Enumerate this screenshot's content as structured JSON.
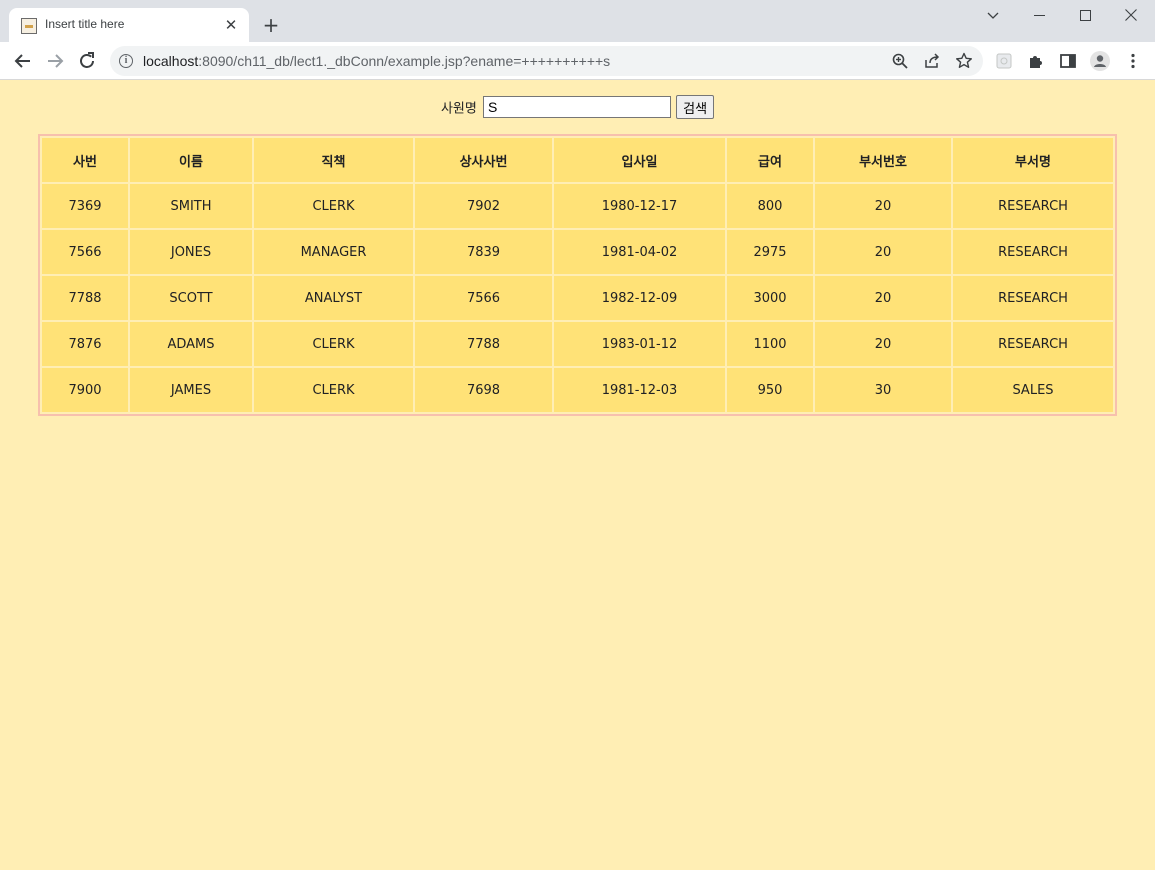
{
  "browser": {
    "tab_title": "Insert title here",
    "url_host": "localhost",
    "url_path": ":8090/ch11_db/lect1._dbConn/example.jsp?ename=++++++++++s"
  },
  "form": {
    "label": "사원명",
    "input_value": "S",
    "button_label": "검색"
  },
  "table": {
    "headers": [
      "사번",
      "이름",
      "직책",
      "상사사번",
      "입사일",
      "급여",
      "부서번호",
      "부서명"
    ],
    "rows": [
      [
        "7369",
        "SMITH",
        "CLERK",
        "7902",
        "1980-12-17",
        "800",
        "20",
        "RESEARCH"
      ],
      [
        "7566",
        "JONES",
        "MANAGER",
        "7839",
        "1981-04-02",
        "2975",
        "20",
        "RESEARCH"
      ],
      [
        "7788",
        "SCOTT",
        "ANALYST",
        "7566",
        "1982-12-09",
        "3000",
        "20",
        "RESEARCH"
      ],
      [
        "7876",
        "ADAMS",
        "CLERK",
        "7788",
        "1983-01-12",
        "1100",
        "20",
        "RESEARCH"
      ],
      [
        "7900",
        "JAMES",
        "CLERK",
        "7698",
        "1981-12-03",
        "950",
        "30",
        "SALES"
      ]
    ]
  }
}
